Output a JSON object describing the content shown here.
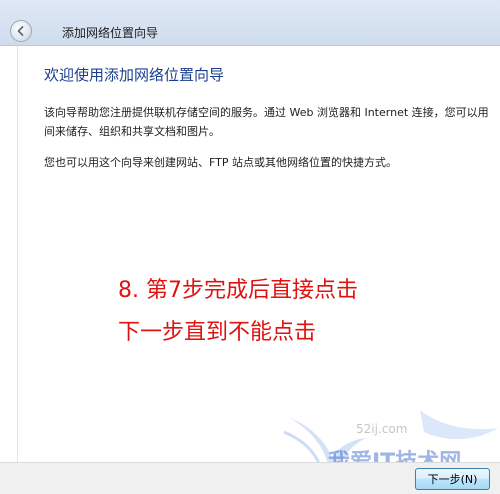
{
  "window": {
    "title": "添加网络位置向导"
  },
  "header": {
    "back_icon": "back-arrow-icon"
  },
  "content": {
    "heading": "欢迎使用添加网络位置向导",
    "description_line1": "该向导帮助您注册提供联机存储空间的服务。通过 Web 浏览器和 Internet 连接，您可以用",
    "description_line2": "间来储存、组织和共享文档和图片。",
    "description_line3": "您也可以用这个向导来创建网站、FTP 站点或其他网络位置的快捷方式。"
  },
  "annotation": {
    "line1": "8. 第7步完成后直接点击",
    "line2": "下一步直到不能点击",
    "color": "#e0120f"
  },
  "watermark": {
    "text": "我爱IT技术网",
    "url": "52ij.com"
  },
  "footer": {
    "next_label": "下一步(N)"
  },
  "colors": {
    "heading": "#1b3f8f",
    "button_border": "#3c7fb1"
  }
}
